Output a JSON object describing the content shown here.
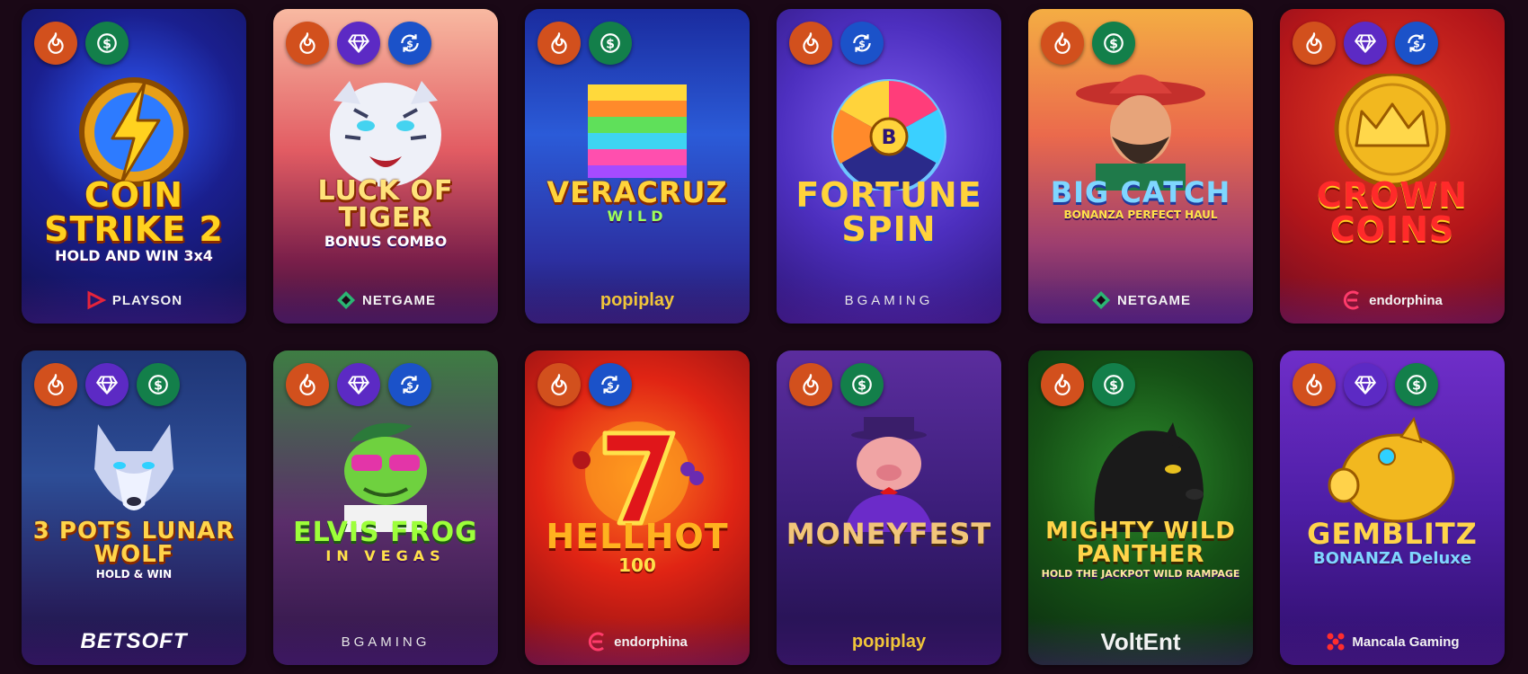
{
  "colors": {
    "page_background": "#1a0816",
    "badge_fire": "#d2501d",
    "badge_gem": "#5c2ac4",
    "badge_dollar": "#137f4a",
    "badge_swap": "#1b52c9"
  },
  "games": [
    {
      "title_main": "COIN STRIKE 2",
      "title_sub": "HOLD AND WIN 3x4",
      "provider": "PLAYSON",
      "badges": [
        "fire-icon",
        "dollar-icon"
      ]
    },
    {
      "title_main": "LUCK OF TIGER",
      "title_sub": "BONUS COMBO",
      "provider": "NETGAME",
      "badges": [
        "fire-icon",
        "diamond-icon",
        "swap-dollar-icon"
      ]
    },
    {
      "title_main": "VERACRUZ",
      "title_sub": "WILD",
      "provider": "popiplay",
      "badges": [
        "fire-icon",
        "dollar-icon"
      ]
    },
    {
      "title_main": "FORTUNE SPIN",
      "title_sub": "",
      "provider": "BGAMING",
      "badges": [
        "fire-icon",
        "swap-dollar-icon"
      ]
    },
    {
      "title_main": "BIG CATCH",
      "title_sub": "BONANZA PERFECT HAUL",
      "provider": "NETGAME",
      "badges": [
        "fire-icon",
        "dollar-icon"
      ]
    },
    {
      "title_main": "CROWN COINS",
      "title_sub": "",
      "provider": "endorphina",
      "badges": [
        "fire-icon",
        "diamond-icon",
        "swap-dollar-icon"
      ]
    },
    {
      "title_main": "3 POTS LUNAR WOLF",
      "title_sub": "HOLD & WIN",
      "provider": "BETSOFT",
      "badges": [
        "fire-icon",
        "diamond-icon",
        "dollar-icon"
      ]
    },
    {
      "title_main": "ELVIS FROG",
      "title_sub": "IN VEGAS",
      "provider": "BGAMING",
      "badges": [
        "fire-icon",
        "diamond-icon",
        "swap-dollar-icon"
      ]
    },
    {
      "title_main": "HELLHOT",
      "title_sub": "100",
      "provider": "endorphina",
      "badges": [
        "fire-icon",
        "swap-dollar-icon"
      ]
    },
    {
      "title_main": "MONEYFEST",
      "title_sub": "",
      "provider": "popiplay",
      "badges": [
        "fire-icon",
        "dollar-icon"
      ]
    },
    {
      "title_main": "MIGHTY WILD PANTHER",
      "title_sub": "HOLD THE JACKPOT WILD RAMPAGE",
      "provider": "VoltEnt",
      "badges": [
        "fire-icon",
        "dollar-icon"
      ]
    },
    {
      "title_main": "GEMBLITZ",
      "title_sub": "BONANZA Deluxe",
      "provider": "Mancala Gaming",
      "badges": [
        "fire-icon",
        "diamond-icon",
        "dollar-icon"
      ]
    }
  ]
}
